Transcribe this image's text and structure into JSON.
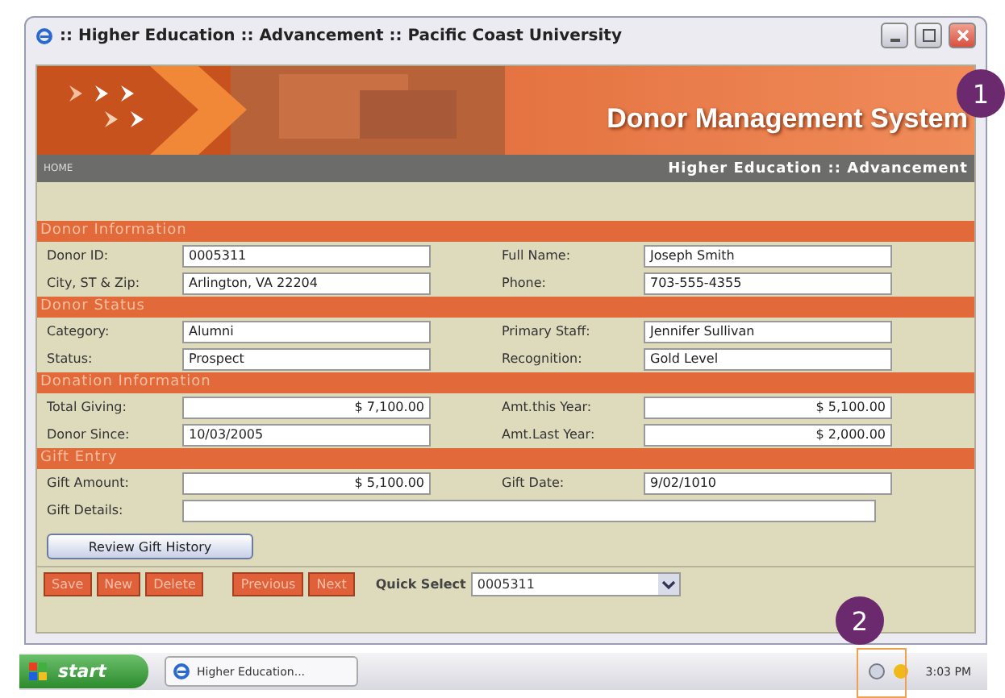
{
  "window": {
    "title": ":: Higher Education :: Advancement :: Pacific Coast University"
  },
  "banner": {
    "title": "Donor Management System"
  },
  "nav": {
    "left": "HOME",
    "right": "Higher Education :: Advancement"
  },
  "sections": [
    {
      "title": "Donor Information",
      "rows": [
        [
          {
            "label": "Donor ID:",
            "value": "0005311",
            "kind": "text"
          },
          {
            "label": "Full Name:",
            "value": "Joseph Smith",
            "kind": "text"
          }
        ],
        [
          {
            "label": "City, ST & Zip:",
            "value": "Arlington, VA 22204",
            "kind": "text"
          },
          {
            "label": "Phone:",
            "value": "703-555-4355",
            "kind": "text"
          }
        ]
      ]
    },
    {
      "title": "Donor Status",
      "rows": [
        [
          {
            "label": "Category:",
            "value": "Alumni",
            "kind": "text"
          },
          {
            "label": "Primary Staff:",
            "value": "Jennifer Sullivan",
            "kind": "text"
          }
        ],
        [
          {
            "label": "Status:",
            "value": "Prospect",
            "kind": "text"
          },
          {
            "label": "Recognition:",
            "value": "Gold Level",
            "kind": "text"
          }
        ]
      ]
    },
    {
      "title": "Donation Information",
      "rows": [
        [
          {
            "label": "Total Giving:",
            "value": "$ 7,100.00",
            "kind": "amount"
          },
          {
            "label": "Amt.this Year:",
            "value": "$ 5,100.00",
            "kind": "amount"
          }
        ],
        [
          {
            "label": "Donor Since:",
            "value": "10/03/2005",
            "kind": "text"
          },
          {
            "label": "Amt.Last Year:",
            "value": "$ 2,000.00",
            "kind": "amount"
          }
        ]
      ]
    },
    {
      "title": "Gift Entry",
      "rows": [
        [
          {
            "label": "Gift Amount:",
            "value": "$ 5,100.00",
            "kind": "amount"
          },
          {
            "label": "Gift Date:",
            "value": "9/02/1010",
            "kind": "text"
          }
        ],
        [
          {
            "label": "Gift Details:",
            "kind": "wide"
          }
        ]
      ]
    }
  ],
  "review_button": "Review Gift History",
  "action_buttons": [
    [
      "Save",
      "New",
      "Delete"
    ],
    [
      "Previous",
      "Next"
    ]
  ],
  "quick_select": {
    "label": "Quick Select",
    "value": "0005311"
  },
  "taskbar": {
    "start": "start",
    "task": "Higher Education...",
    "time": "3:03 PM"
  },
  "callouts": [
    "1",
    "2"
  ]
}
